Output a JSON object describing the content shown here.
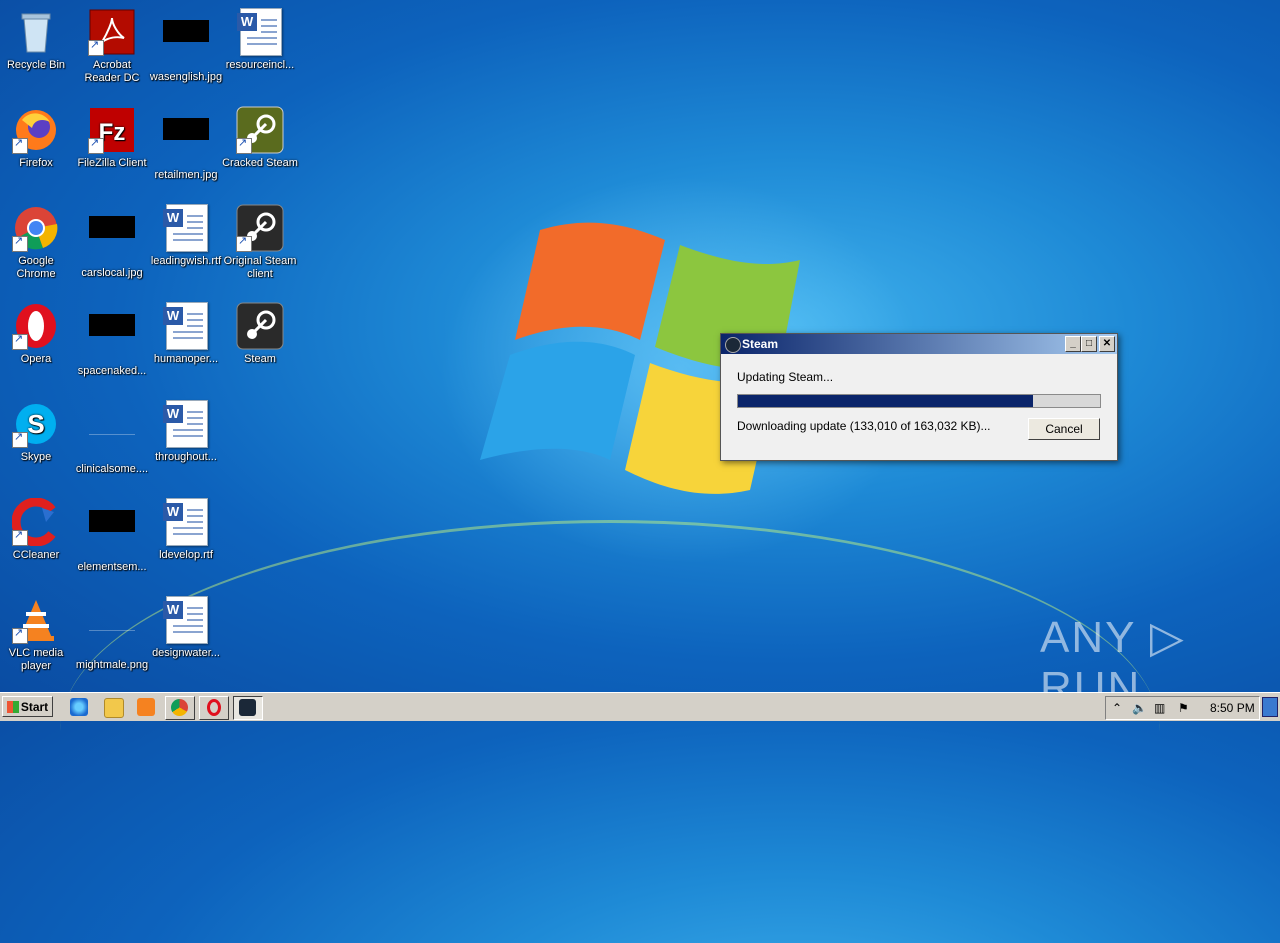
{
  "desktop_icons": [
    {
      "label": "Recycle Bin",
      "icon": "recycle-bin-icon"
    },
    {
      "label": "Acrobat Reader DC",
      "icon": "acrobat-icon"
    },
    {
      "label": "wasenglish.jpg",
      "icon": "image-file-icon"
    },
    {
      "label": "resourceincl...",
      "icon": "word-doc-icon"
    },
    {
      "label": "Firefox",
      "icon": "firefox-icon"
    },
    {
      "label": "FileZilla Client",
      "icon": "filezilla-icon"
    },
    {
      "label": "retailmen.jpg",
      "icon": "image-file-icon"
    },
    {
      "label": "Cracked Steam",
      "icon": "steam-icon"
    },
    {
      "label": "Google Chrome",
      "icon": "chrome-icon"
    },
    {
      "label": "carslocal.jpg",
      "icon": "image-file-icon"
    },
    {
      "label": "leadingwish.rtf",
      "icon": "word-doc-icon"
    },
    {
      "label": "Original Steam client",
      "icon": "steam-icon"
    },
    {
      "label": "Opera",
      "icon": "opera-icon"
    },
    {
      "label": "spacenaked...",
      "icon": "image-file-icon"
    },
    {
      "label": "humanoper...",
      "icon": "word-doc-icon"
    },
    {
      "label": "Steam",
      "icon": "steam-icon"
    },
    {
      "label": "Skype",
      "icon": "skype-icon"
    },
    {
      "label": "clinicalsome....",
      "icon": "image-file-icon"
    },
    {
      "label": "throughout...",
      "icon": "word-doc-icon"
    },
    {
      "label": "CCleaner",
      "icon": "ccleaner-icon"
    },
    {
      "label": "elementsem...",
      "icon": "image-file-icon"
    },
    {
      "label": "ldevelop.rtf",
      "icon": "word-doc-icon"
    },
    {
      "label": "VLC media player",
      "icon": "vlc-icon"
    },
    {
      "label": "mightmale.png",
      "icon": "image-file-icon"
    },
    {
      "label": "designwater...",
      "icon": "word-doc-icon"
    }
  ],
  "dialog": {
    "title": "Steam",
    "status": "Updating Steam...",
    "detail": "Downloading update (133,010 of 163,032 KB)...",
    "progress": 0.816,
    "cancel_label": "Cancel",
    "minimize": "_",
    "maximize": "□",
    "close": "✕"
  },
  "watermark": "ANY ▷ RUN",
  "taskbar": {
    "start_label": "Start",
    "clock": "8:50 PM",
    "quick_launch": [
      "ie-icon",
      "explorer-icon",
      "media-player-icon",
      "chrome-icon",
      "opera-icon",
      "steam-icon"
    ]
  },
  "colors": {
    "titlebar_start": "#0a246a",
    "titlebar_end": "#a6caf0",
    "progress_fill": "#0a246a",
    "taskbar": "#d4d0c8"
  }
}
